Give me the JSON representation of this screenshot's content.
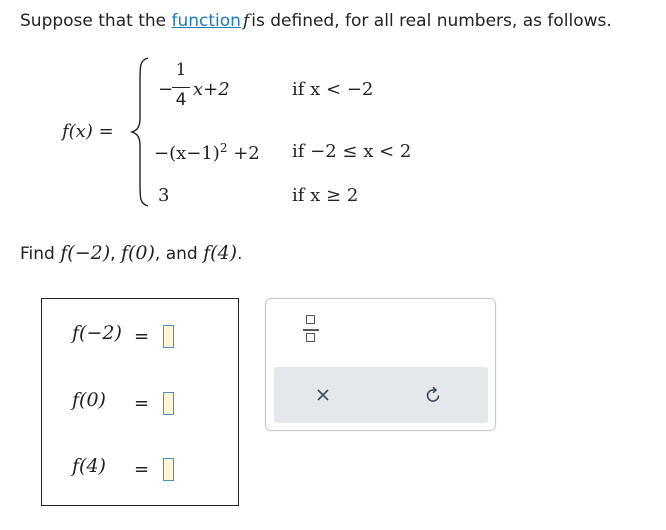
{
  "prompt": {
    "before": "Suppose that the ",
    "link": "function",
    "f": "f",
    "after": "is defined, for all real numbers, as follows."
  },
  "definition": {
    "lhs": "f(x) =",
    "pieces": [
      {
        "expr_frac_num": "1",
        "expr_frac_den": "4",
        "expr_neg": "−",
        "expr_rest": "x+2",
        "condition": "if x < −2"
      },
      {
        "expr": "−(x−1)",
        "expr_exp": "2",
        "expr_tail": "+2",
        "condition": "if −2 ≤ x < 2"
      },
      {
        "expr": "3",
        "condition": "if x ≥ 2"
      }
    ]
  },
  "find": {
    "label": "Find",
    "items": [
      "f(−2)",
      "f(0)",
      "f(4)"
    ],
    "joiner1": ", ",
    "joiner2": ", and ",
    "end": "."
  },
  "answers": [
    {
      "lhs": "f(−2)",
      "eq": "=",
      "value": ""
    },
    {
      "lhs": "f(0)",
      "eq": "=",
      "value": ""
    },
    {
      "lhs": "f(4)",
      "eq": "=",
      "value": ""
    }
  ],
  "tools": {
    "fraction": "fraction-icon",
    "clear": "clear-x-icon",
    "undo": "undo-icon",
    "clear_glyph": "×",
    "undo_glyph": "↺"
  },
  "colors": {
    "link": "#1f7bb6",
    "input_fill": "#fff6d6",
    "input_border": "#4e8fc7",
    "toolbar": "#e4e7eb"
  }
}
